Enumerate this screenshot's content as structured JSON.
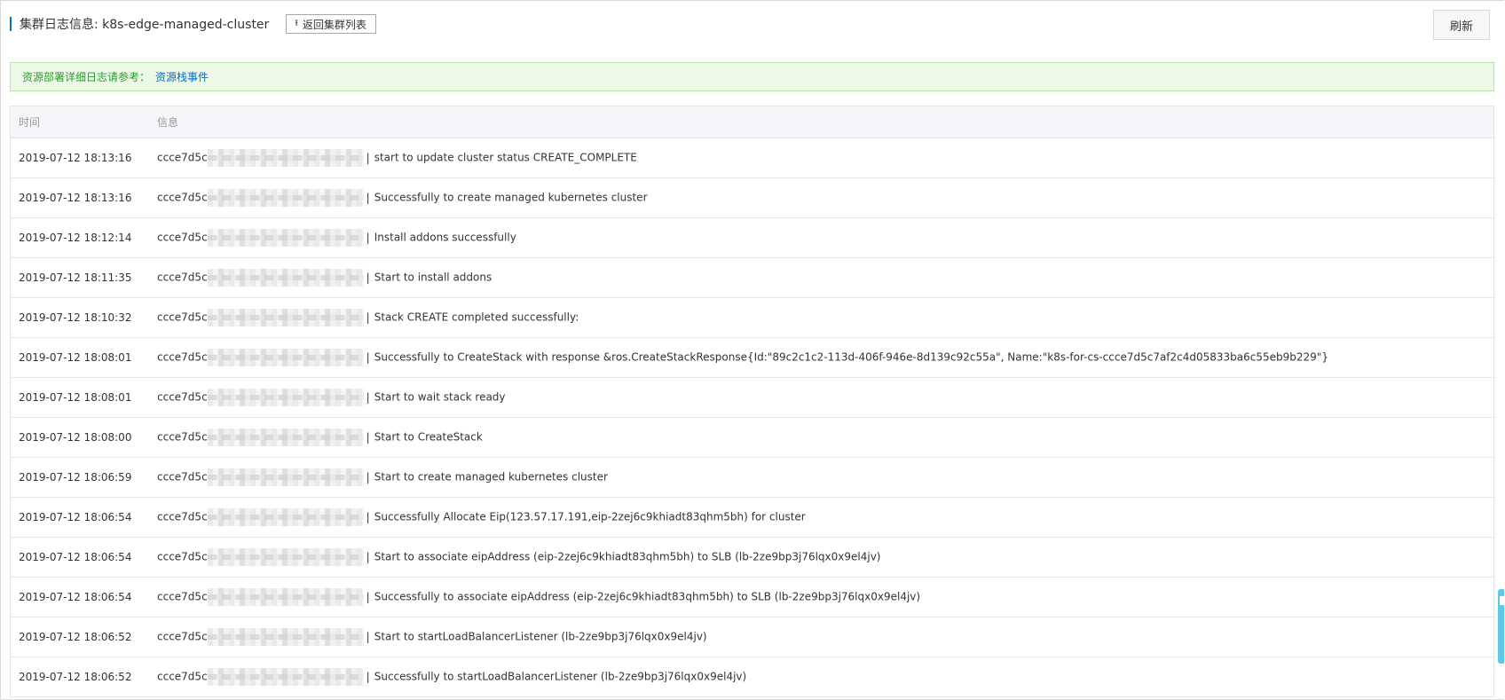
{
  "header": {
    "title": "集群日志信息: k8s-edge-managed-cluster",
    "back_label": "返回集群列表",
    "back_icon": "upload-arrow-icon",
    "refresh_label": "刷新"
  },
  "notice": {
    "text": "资源部署详细日志请参考：",
    "link": "资源栈事件"
  },
  "table": {
    "columns": [
      "时间",
      "信息"
    ],
    "cluster_prefix": "ccce7d5c",
    "separator": "|",
    "rows": [
      {
        "time": "2019-07-12 18:13:16",
        "message": "start to update cluster status CREATE_COMPLETE"
      },
      {
        "time": "2019-07-12 18:13:16",
        "message": "Successfully to create managed kubernetes cluster"
      },
      {
        "time": "2019-07-12 18:12:14",
        "message": "Install addons successfully"
      },
      {
        "time": "2019-07-12 18:11:35",
        "message": "Start to install addons"
      },
      {
        "time": "2019-07-12 18:10:32",
        "message": "Stack CREATE completed successfully:"
      },
      {
        "time": "2019-07-12 18:08:01",
        "message": "Successfully to CreateStack with response &ros.CreateStackResponse{Id:\"89c2c1c2-113d-406f-946e-8d139c92c55a\", Name:\"k8s-for-cs-ccce7d5c7af2c4d05833ba6c55eb9b229\"}"
      },
      {
        "time": "2019-07-12 18:08:01",
        "message": "Start to wait stack ready"
      },
      {
        "time": "2019-07-12 18:08:00",
        "message": "Start to CreateStack"
      },
      {
        "time": "2019-07-12 18:06:59",
        "message": "Start to create managed kubernetes cluster"
      },
      {
        "time": "2019-07-12 18:06:54",
        "message": "Successfully Allocate Eip(123.57.17.191,eip-2zej6c9khiadt83qhm5bh) for cluster"
      },
      {
        "time": "2019-07-12 18:06:54",
        "message": "Start to associate eipAddress (eip-2zej6c9khiadt83qhm5bh) to SLB (lb-2ze9bp3j76lqx0x9el4jv)"
      },
      {
        "time": "2019-07-12 18:06:54",
        "message": "Successfully to associate eipAddress (eip-2zej6c9khiadt83qhm5bh) to SLB (lb-2ze9bp3j76lqx0x9el4jv)"
      },
      {
        "time": "2019-07-12 18:06:52",
        "message": "Start to startLoadBalancerListener (lb-2ze9bp3j76lqx0x9el4jv)"
      },
      {
        "time": "2019-07-12 18:06:52",
        "message": "Successfully to startLoadBalancerListener (lb-2ze9bp3j76lqx0x9el4jv)"
      }
    ]
  },
  "colors": {
    "accent": "#0070cc",
    "notice_text": "#2e9d2e",
    "notice_bg": "#ebf9e6",
    "side_handle": "#5ec8e6"
  }
}
